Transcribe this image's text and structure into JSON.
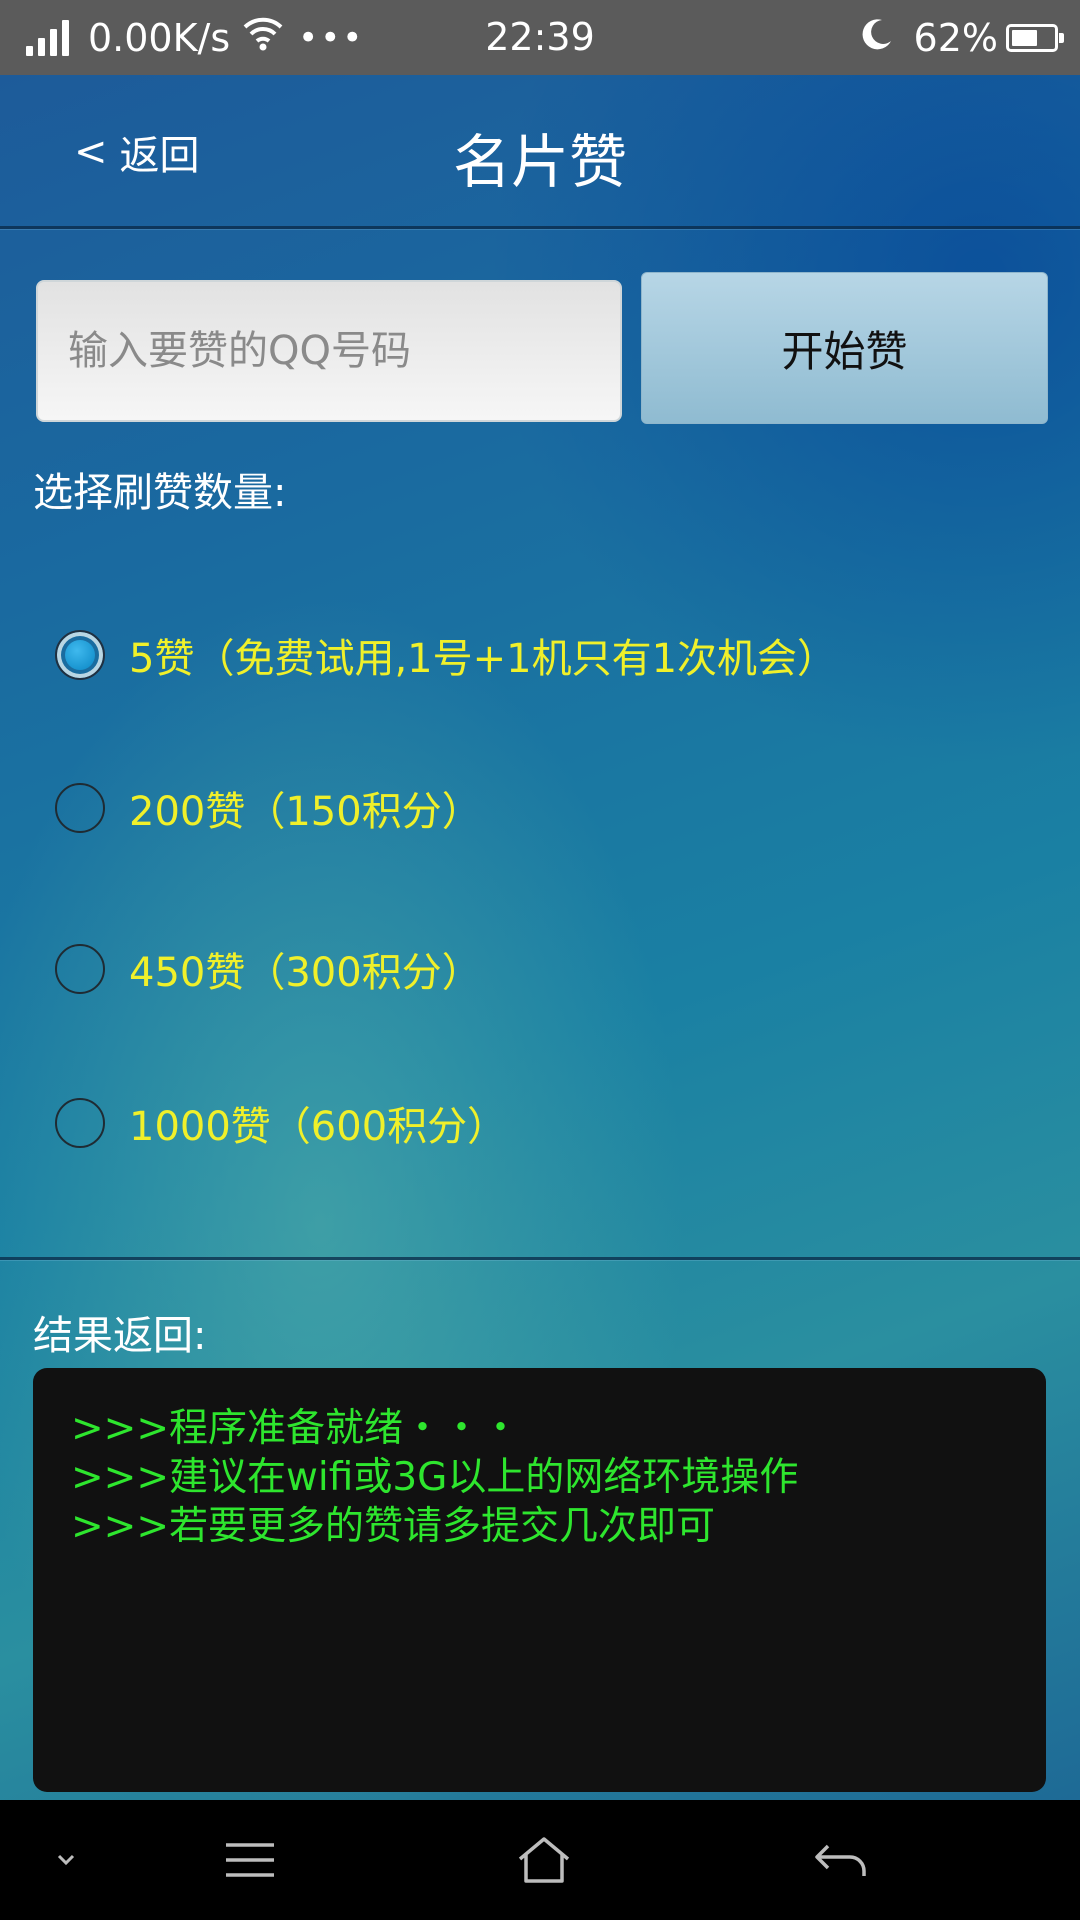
{
  "status_bar": {
    "network_speed": "0.00K/s",
    "more": "•••",
    "time": "22:39",
    "battery": "62%",
    "battery_level": 0.62
  },
  "header": {
    "back_label": "返回",
    "back_chevron": "<",
    "title": "名片赞"
  },
  "form": {
    "qq_placeholder": "输入要赞的QQ号码",
    "qq_value": "",
    "start_button": "开始赞",
    "quantity_label": "选择刷赞数量:"
  },
  "options": [
    {
      "label": "5赞（免费试用,1号+1机只有1次机会）",
      "checked": true
    },
    {
      "label": "200赞（150积分）",
      "checked": false
    },
    {
      "label": "450赞（300积分）",
      "checked": false
    },
    {
      "label": "1000赞（600积分）",
      "checked": false
    }
  ],
  "result": {
    "label": "结果返回:",
    "lines": [
      ">>>程序准备就绪・・・",
      ">>>建议在wifi或3G以上的网络环境操作",
      ">>>若要更多的赞请多提交几次即可"
    ]
  },
  "colors": {
    "option_text": "#f0f02a",
    "console_text": "#2ee62e",
    "console_bg": "#111111"
  },
  "icons": {
    "nav_collapse": "chevron-down-icon",
    "nav_menu": "menu-icon",
    "nav_home": "home-icon",
    "nav_back": "back-arrow-icon"
  }
}
